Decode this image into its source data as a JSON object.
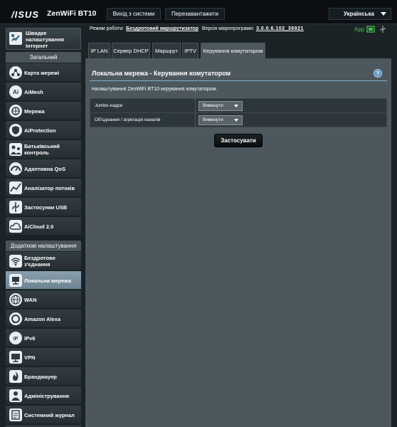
{
  "header": {
    "brand": "/ISUS",
    "model": "ZenWiFi BT10",
    "logout_label": "Вихід з системи",
    "reboot_label": "Перезавантажити",
    "language": "Українська"
  },
  "sidebar": {
    "qis_label": "Швидке налаштування Інтернет",
    "general_header": "Загальний",
    "general_items": [
      {
        "label": "Карта мережі",
        "icon": "network-map-icon"
      },
      {
        "label": "AiMesh",
        "icon": "aimesh-icon"
      },
      {
        "label": "Мережа",
        "icon": "network-icon"
      },
      {
        "label": "AiProtection",
        "icon": "shield-icon"
      },
      {
        "label": "Батьківський контроль",
        "icon": "parental-control-icon"
      },
      {
        "label": "Адаптивна QoS",
        "icon": "qos-gauge-icon"
      },
      {
        "label": "Аналізатор потоків",
        "icon": "traffic-analyzer-icon"
      },
      {
        "label": "Застосунки USB",
        "icon": "usb-apps-icon"
      },
      {
        "label": "AiCloud 2.0",
        "icon": "cloud-icon"
      }
    ],
    "advanced_header": "Додаткові налаштування",
    "advanced_items": [
      {
        "label": "Бездротове з'єднання",
        "icon": "wireless-icon"
      },
      {
        "label": "Локальна мережа",
        "icon": "lan-icon"
      },
      {
        "label": "WAN",
        "icon": "globe-icon"
      },
      {
        "label": "Amazon Alexa",
        "icon": "alexa-icon"
      },
      {
        "label": "IPv6",
        "icon": "ipv6-icon"
      },
      {
        "label": "VPN",
        "icon": "vpn-icon"
      },
      {
        "label": "Брандмауер",
        "icon": "firewall-icon"
      },
      {
        "label": "Адміністрування",
        "icon": "admin-icon"
      },
      {
        "label": "Системний журнал",
        "icon": "system-log-icon"
      }
    ]
  },
  "status": {
    "mode_label": "Режим роботи:",
    "mode_value": "Бездротовий маршрутизатор",
    "fw_label": "Версія мікропрограми:",
    "fw_value": "3.0.0.6.102_36921",
    "app_label": "App"
  },
  "tabs": [
    {
      "label": "IP LAN"
    },
    {
      "label": "Сервер DHCP"
    },
    {
      "label": "Маршрут"
    },
    {
      "label": "IPTV"
    },
    {
      "label": "Керування комутатором"
    }
  ],
  "main": {
    "title": "Локальна мережа - Керування комутатором",
    "help_symbol": "?",
    "description": "Налаштування ZenWiFi BT10 керування комутатором.",
    "settings": [
      {
        "label": "Jumbo-кадри",
        "value": "Вимкнути"
      },
      {
        "label": "Об'єднання / агрегація каналів",
        "value": "Вимкнути"
      }
    ],
    "apply_label": "Застосувати"
  },
  "colors": {
    "accent": "#83b1d0",
    "panel": "#4d585e",
    "active_nav": "#7f95a3",
    "app_green": "#4ac24a"
  }
}
